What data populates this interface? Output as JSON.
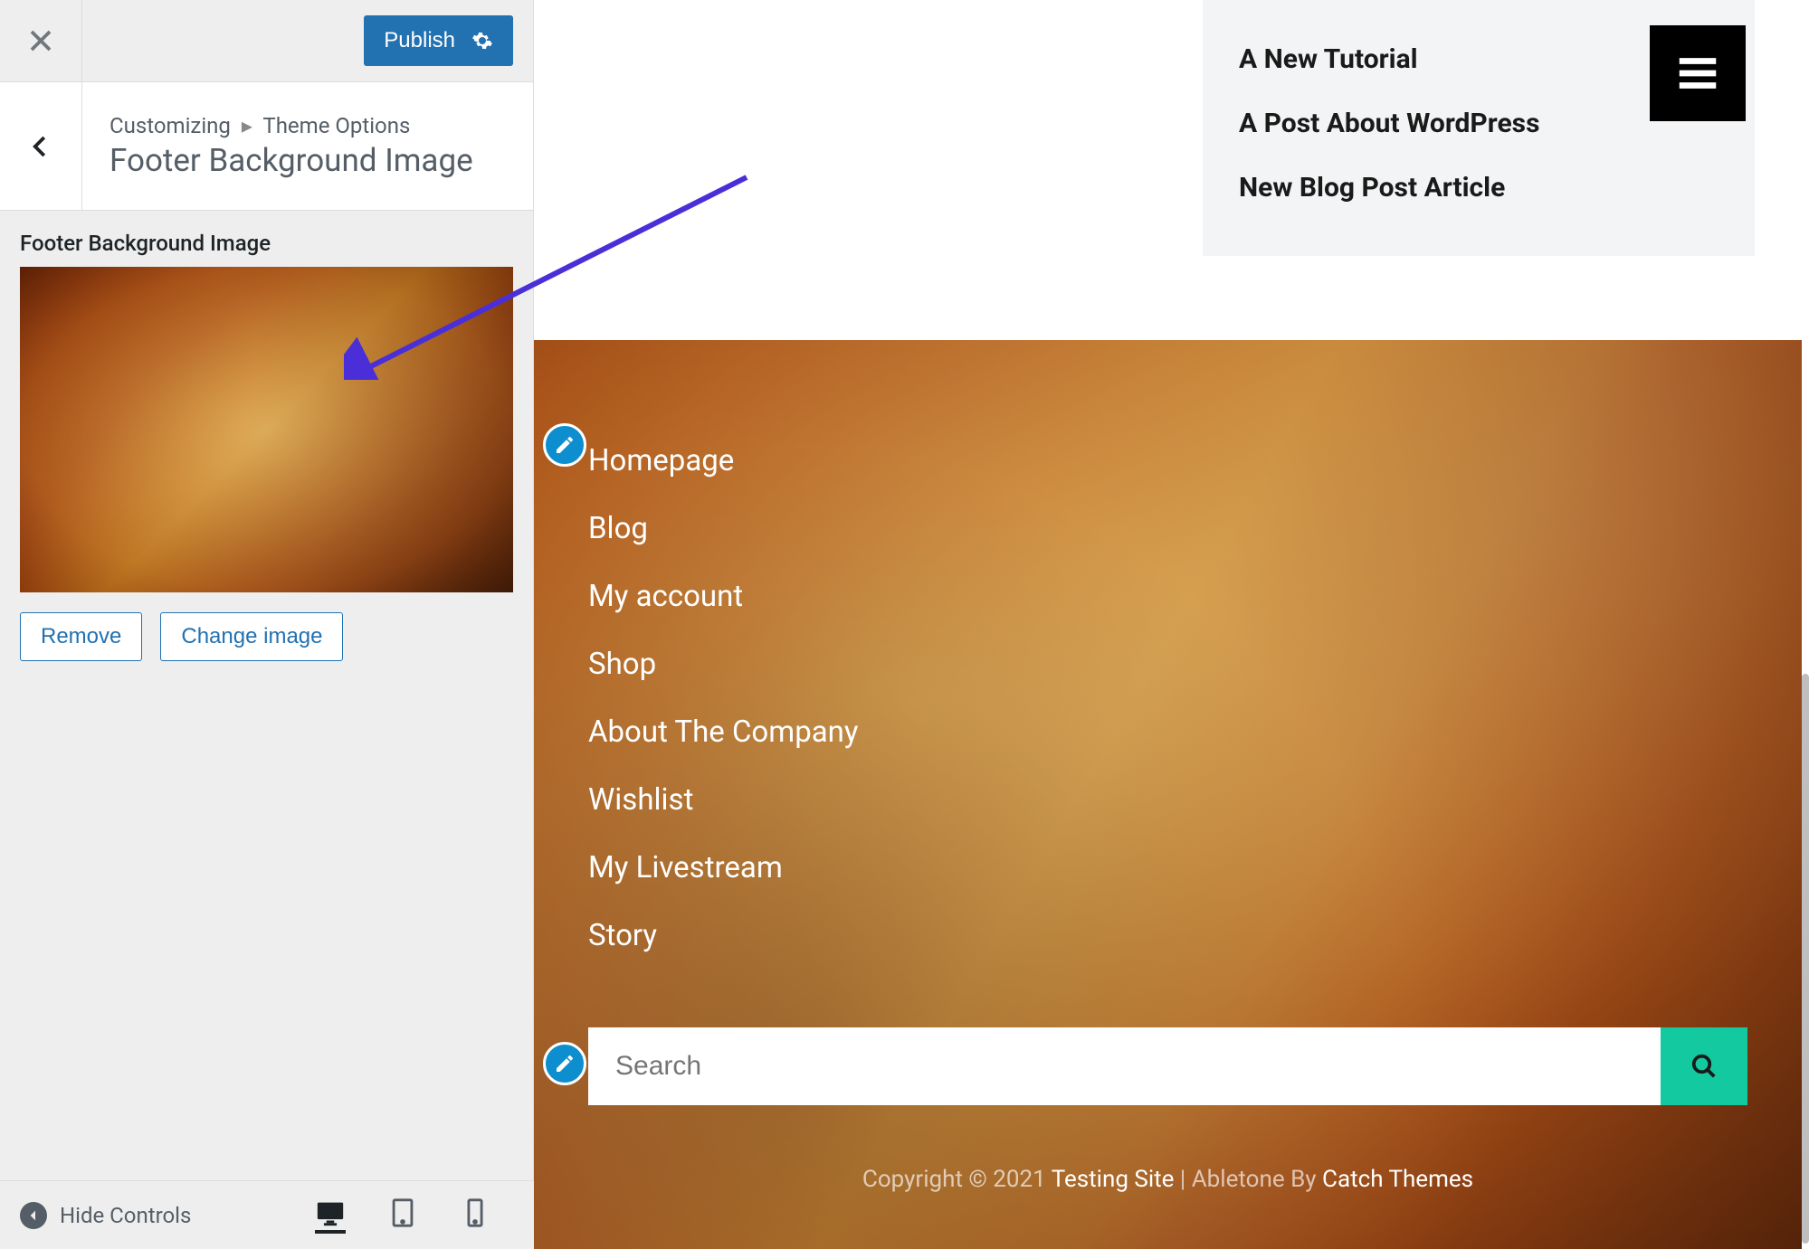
{
  "header": {
    "publish_label": "Publish"
  },
  "breadcrumb": {
    "parent": "Customizing",
    "child": "Theme Options"
  },
  "panel": {
    "title": "Footer Background Image",
    "field_label": "Footer Background Image",
    "remove_label": "Remove",
    "change_label": "Change image"
  },
  "device_bar": {
    "collapse_label": "Hide Controls"
  },
  "recent_posts": [
    "A New Tutorial",
    "A Post About WordPress",
    "New Blog Post Article"
  ],
  "footer_nav": [
    "Homepage",
    "Blog",
    "My account",
    "Shop",
    "About The Company",
    "Wishlist",
    "My Livestream",
    "Story"
  ],
  "search": {
    "placeholder": "Search"
  },
  "copyright": {
    "prefix": "Copyright © 2021 ",
    "site": "Testing Site",
    "mid1": " | ",
    "theme_prefix": "Abletone By ",
    "theme_author": "Catch Themes"
  },
  "colors": {
    "accent": "#2271b1",
    "teal": "#12c9a0",
    "arrow": "#4a2fd9"
  }
}
